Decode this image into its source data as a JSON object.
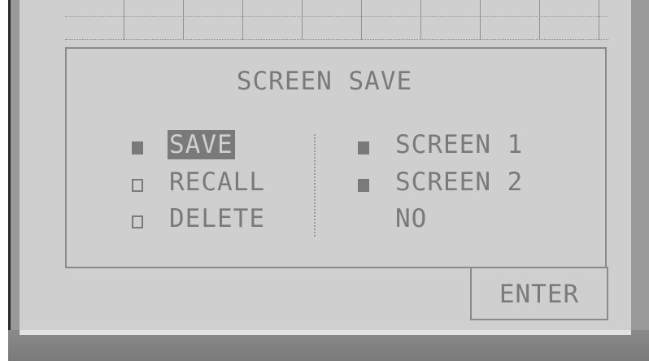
{
  "dialog": {
    "title": "SCREEN SAVE",
    "left_options": [
      {
        "label": "SAVE",
        "state": "selected",
        "mark": "filled-square-icon"
      },
      {
        "label": "RECALL",
        "state": "unselected",
        "mark": "empty-square-icon"
      },
      {
        "label": "DELETE",
        "state": "unselected",
        "mark": "empty-square-icon"
      }
    ],
    "right_options": [
      {
        "label": "SCREEN 1",
        "mark": "filled-square-icon"
      },
      {
        "label": "SCREEN 2",
        "mark": "filled-square-icon"
      },
      {
        "label": "NO",
        "mark": ""
      }
    ],
    "enter_label": "ENTER"
  },
  "colors": {
    "lcd_background": "#cfcfcf",
    "text": "#7a7a7a",
    "bezel": "#9a9a9a"
  }
}
